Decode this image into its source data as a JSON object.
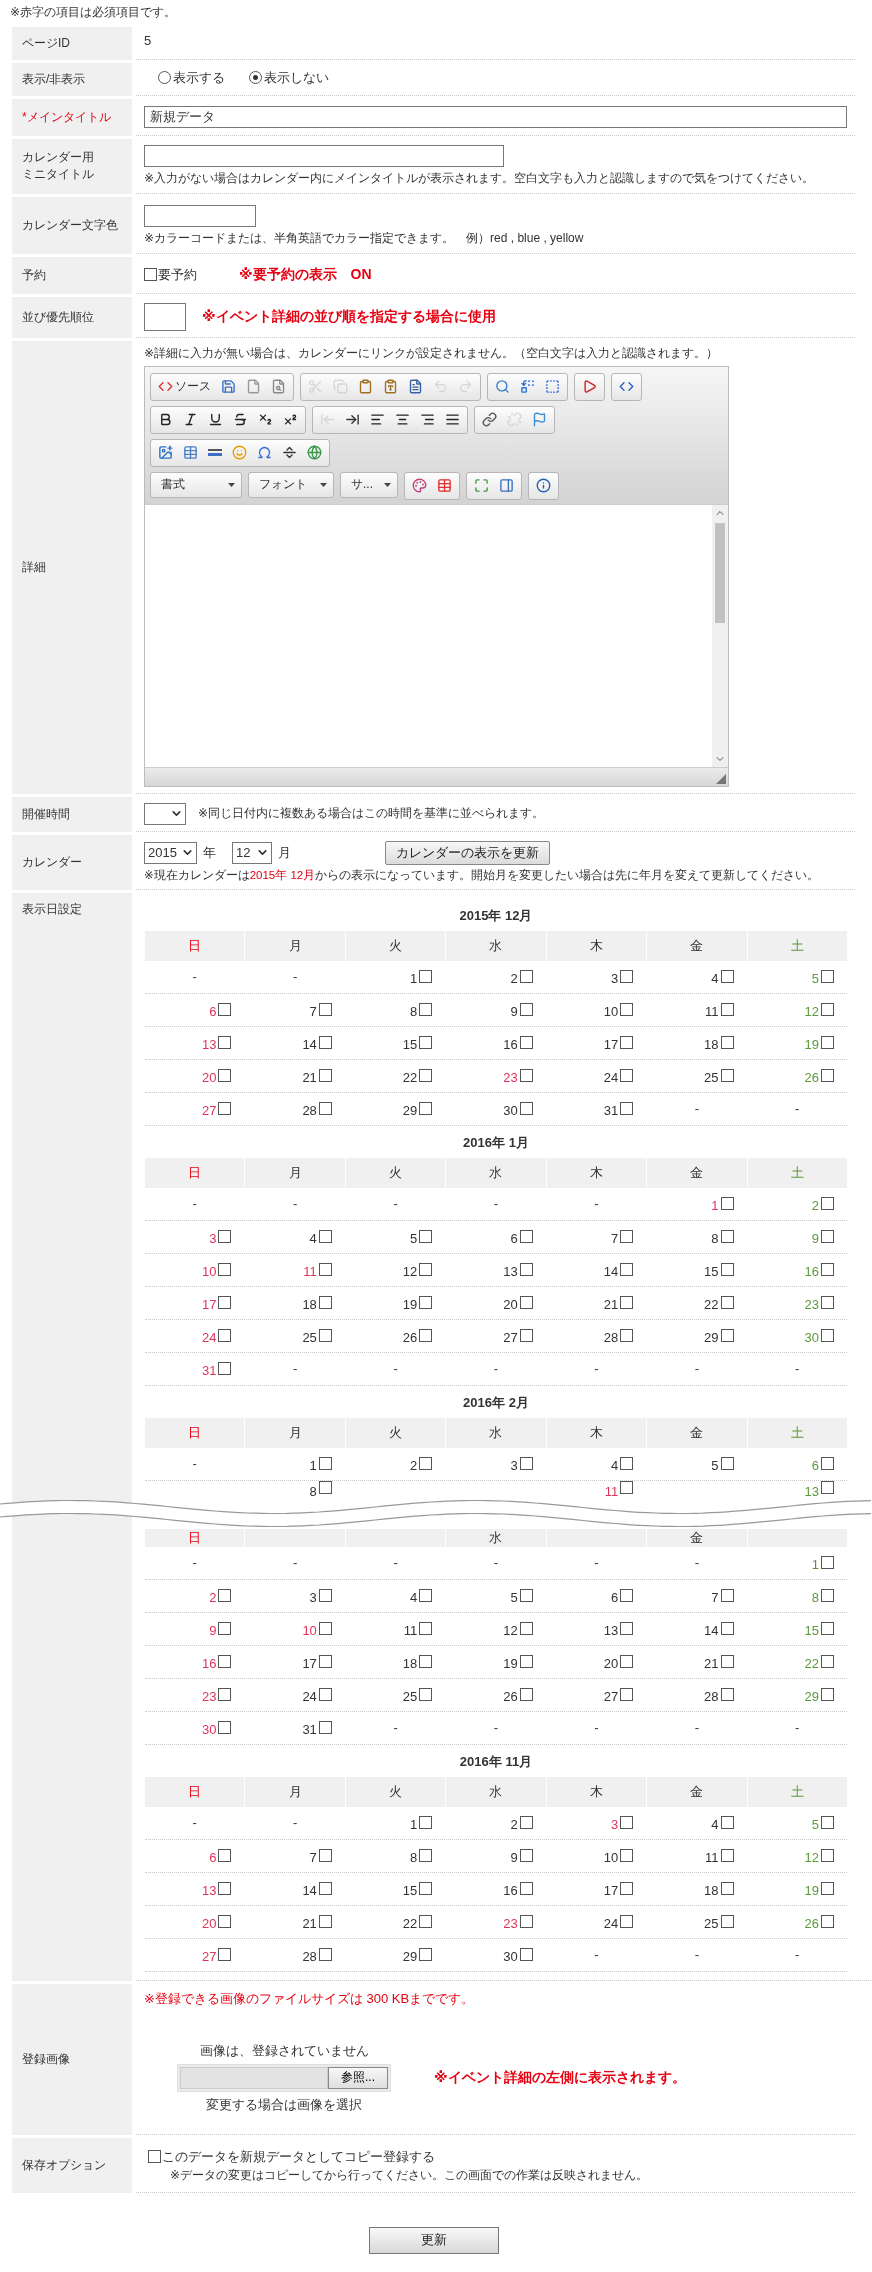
{
  "notice": "※赤字の項目は必須項目です。",
  "rows": [
    {
      "kind": "static",
      "label": "ページID",
      "required": false,
      "value": "5"
    },
    {
      "kind": "radio",
      "label": "表示/非表示",
      "required": false,
      "options": [
        {
          "label": "表示する",
          "selected": false
        },
        {
          "label": "表示しない",
          "selected": true
        }
      ]
    },
    {
      "kind": "title",
      "label": "*メインタイトル",
      "required": true,
      "value": "新規データ"
    },
    {
      "kind": "mini_title",
      "label": "カレンダー用ミニタイトル",
      "required": false,
      "note": "※入力がない場合はカレンダー内にメインタイトルが表示されます。空白文字も入力と認識しますので気をつけてください。"
    },
    {
      "kind": "color",
      "label": "カレンダー文字色",
      "required": false,
      "note": "※カラーコードまたは、半角英語でカラー指定できます。　例）red , blue , yellow"
    },
    {
      "kind": "reserve",
      "label": "予約",
      "required": false,
      "checkbox": {
        "label": "要予約",
        "checked": false
      },
      "note": "※要予約の表示　ON"
    },
    {
      "kind": "order",
      "label": "並び優先順位",
      "required": false,
      "note": "※イベント詳細の並び順を指定する場合に使用"
    },
    {
      "kind": "editor",
      "label": "詳細",
      "required": false,
      "note": "※詳細に入力が無い場合は、カレンダーにリンクが設定されません。（空白文字は入力と認識されます。）",
      "toolbar": [
        [
          {
            "kind": "buttons",
            "tools": [
              {
                "kind": "source",
                "label": "ソース",
                "disabled": false
              },
              {
                "kind": "save",
                "disabled": false
              },
              {
                "kind": "new_page",
                "disabled": false
              },
              {
                "kind": "preview",
                "disabled": false
              }
            ]
          },
          {
            "kind": "buttons",
            "tools": [
              {
                "kind": "cut",
                "disabled": true
              },
              {
                "kind": "copy",
                "disabled": true
              },
              {
                "kind": "paste",
                "disabled": false
              },
              {
                "kind": "paste_text",
                "disabled": false
              },
              {
                "kind": "paste_word",
                "disabled": false
              },
              {
                "kind": "undo",
                "disabled": true
              },
              {
                "kind": "redo",
                "disabled": true
              }
            ]
          },
          {
            "kind": "buttons",
            "tools": [
              {
                "kind": "find",
                "disabled": false
              },
              {
                "kind": "replace",
                "disabled": false
              },
              {
                "kind": "select_all",
                "disabled": false
              }
            ]
          },
          {
            "kind": "buttons",
            "tools": [
              {
                "kind": "video",
                "disabled": false
              }
            ]
          },
          {
            "kind": "buttons",
            "tools": [
              {
                "kind": "html",
                "disabled": false
              }
            ]
          }
        ],
        [
          {
            "kind": "buttons",
            "tools": [
              {
                "kind": "bold",
                "disabled": false
              },
              {
                "kind": "italic",
                "disabled": false
              },
              {
                "kind": "underline",
                "disabled": false
              },
              {
                "kind": "strike",
                "disabled": false
              },
              {
                "kind": "subscript",
                "disabled": false
              },
              {
                "kind": "superscript",
                "disabled": false
              }
            ]
          },
          {
            "kind": "buttons",
            "tools": [
              {
                "kind": "outdent",
                "disabled": true
              },
              {
                "kind": "indent",
                "disabled": false
              },
              {
                "kind": "align_left",
                "disabled": false
              },
              {
                "kind": "align_center",
                "disabled": false
              },
              {
                "kind": "align_right",
                "disabled": false
              },
              {
                "kind": "justify",
                "disabled": false
              }
            ]
          },
          {
            "kind": "buttons",
            "tools": [
              {
                "kind": "link",
                "disabled": false
              },
              {
                "kind": "unlink",
                "disabled": true
              },
              {
                "kind": "anchor",
                "disabled": false
              }
            ]
          }
        ],
        [
          {
            "kind": "buttons",
            "tools": [
              {
                "kind": "image",
                "disabled": false
              },
              {
                "kind": "table",
                "disabled": false
              },
              {
                "kind": "rule",
                "disabled": false
              },
              {
                "kind": "smiley",
                "disabled": false
              },
              {
                "kind": "special_char",
                "disabled": false
              },
              {
                "kind": "page_break",
                "disabled": false
              },
              {
                "kind": "iframe",
                "disabled": false
              }
            ]
          }
        ],
        [
          {
            "kind": "combo",
            "label": "書式"
          },
          {
            "kind": "combo",
            "label": "フォント"
          },
          {
            "kind": "combo",
            "label": "サ..."
          },
          {
            "kind": "buttons",
            "tools": [
              {
                "kind": "text_color",
                "disabled": false
              },
              {
                "kind": "bg_color",
                "disabled": false
              }
            ]
          },
          {
            "kind": "buttons",
            "tools": [
              {
                "kind": "maximize",
                "disabled": false
              },
              {
                "kind": "show_blocks",
                "disabled": false
              }
            ]
          },
          {
            "kind": "buttons",
            "tools": [
              {
                "kind": "about",
                "disabled": false
              }
            ]
          }
        ]
      ]
    },
    {
      "kind": "time",
      "label": "開催時間",
      "required": false,
      "note": "※同じ日付内に複数ある場合はこの時間を基準に並べられます。"
    },
    {
      "kind": "calendar",
      "label": "カレンダー",
      "required": false,
      "year": "2015",
      "year_unit": "年",
      "month": "12",
      "month_unit": "月",
      "button": "カレンダーの表示を更新",
      "note_before": "※現在カレンダーは",
      "note_highlight": "2015年 12月",
      "note_after": "からの表示になっています。開始月を変更したい場合は先に年月を変えて更新してください。"
    },
    {
      "kind": "days",
      "label": "表示日設定",
      "required": false,
      "months": [
        {
          "kind": "month",
          "title": "2015年 12月",
          "weekdays": [
            {
              "label": "日",
              "kind": "sunday"
            },
            {
              "label": "月",
              "kind": "weekday"
            },
            {
              "label": "火",
              "kind": "weekday"
            },
            {
              "label": "水",
              "kind": "weekday"
            },
            {
              "label": "木",
              "kind": "weekday"
            },
            {
              "label": "金",
              "kind": "weekday"
            },
            {
              "label": "土",
              "kind": "saturday"
            }
          ],
          "weeks": [
            [
              {
                "day": "-",
                "kind": "blank"
              },
              {
                "day": "-",
                "kind": "blank"
              },
              {
                "day": "1",
                "kind": "weekday",
                "checked": false
              },
              {
                "day": "2",
                "kind": "weekday",
                "checked": false
              },
              {
                "day": "3",
                "kind": "weekday",
                "checked": false
              },
              {
                "day": "4",
                "kind": "weekday",
                "checked": false
              },
              {
                "day": "5",
                "kind": "saturday",
                "checked": false
              }
            ],
            [
              {
                "day": "6",
                "kind": "sunday",
                "checked": false
              },
              {
                "day": "7",
                "kind": "weekday",
                "checked": false
              },
              {
                "day": "8",
                "kind": "weekday",
                "checked": false
              },
              {
                "day": "9",
                "kind": "weekday",
                "checked": false
              },
              {
                "day": "10",
                "kind": "weekday",
                "checked": false
              },
              {
                "day": "11",
                "kind": "weekday",
                "checked": false
              },
              {
                "day": "12",
                "kind": "saturday",
                "checked": false
              }
            ],
            [
              {
                "day": "13",
                "kind": "sunday",
                "checked": false
              },
              {
                "day": "14",
                "kind": "weekday",
                "checked": false
              },
              {
                "day": "15",
                "kind": "weekday",
                "checked": false
              },
              {
                "day": "16",
                "kind": "weekday",
                "checked": false
              },
              {
                "day": "17",
                "kind": "weekday",
                "checked": false
              },
              {
                "day": "18",
                "kind": "weekday",
                "checked": false
              },
              {
                "day": "19",
                "kind": "saturday",
                "checked": false
              }
            ],
            [
              {
                "day": "20",
                "kind": "sunday",
                "checked": false
              },
              {
                "day": "21",
                "kind": "weekday",
                "checked": false
              },
              {
                "day": "22",
                "kind": "weekday",
                "checked": false
              },
              {
                "day": "23",
                "kind": "holiday",
                "checked": false
              },
              {
                "day": "24",
                "kind": "weekday",
                "checked": false
              },
              {
                "day": "25",
                "kind": "weekday",
                "checked": false
              },
              {
                "day": "26",
                "kind": "saturday",
                "checked": false
              }
            ],
            [
              {
                "day": "27",
                "kind": "sunday",
                "checked": false
              },
              {
                "day": "28",
                "kind": "weekday",
                "checked": false
              },
              {
                "day": "29",
                "kind": "weekday",
                "checked": false
              },
              {
                "day": "30",
                "kind": "weekday",
                "checked": false
              },
              {
                "day": "31",
                "kind": "weekday",
                "checked": false
              },
              {
                "day": "-",
                "kind": "blank"
              },
              {
                "day": "-",
                "kind": "blank"
              }
            ]
          ]
        },
        {
          "kind": "month",
          "title": "2016年 1月",
          "weekdays": [
            {
              "label": "日",
              "kind": "sunday"
            },
            {
              "label": "月",
              "kind": "weekday"
            },
            {
              "label": "火",
              "kind": "weekday"
            },
            {
              "label": "水",
              "kind": "weekday"
            },
            {
              "label": "木",
              "kind": "weekday"
            },
            {
              "label": "金",
              "kind": "weekday"
            },
            {
              "label": "土",
              "kind": "saturday"
            }
          ],
          "weeks": [
            [
              {
                "day": "-",
                "kind": "blank"
              },
              {
                "day": "-",
                "kind": "blank"
              },
              {
                "day": "-",
                "kind": "blank"
              },
              {
                "day": "-",
                "kind": "blank"
              },
              {
                "day": "-",
                "kind": "blank"
              },
              {
                "day": "1",
                "kind": "holiday",
                "checked": false
              },
              {
                "day": "2",
                "kind": "saturday",
                "checked": false
              }
            ],
            [
              {
                "day": "3",
                "kind": "sunday",
                "checked": false
              },
              {
                "day": "4",
                "kind": "weekday",
                "checked": false
              },
              {
                "day": "5",
                "kind": "weekday",
                "checked": false
              },
              {
                "day": "6",
                "kind": "weekday",
                "checked": false
              },
              {
                "day": "7",
                "kind": "weekday",
                "checked": false
              },
              {
                "day": "8",
                "kind": "weekday",
                "checked": false
              },
              {
                "day": "9",
                "kind": "saturday",
                "checked": false
              }
            ],
            [
              {
                "day": "10",
                "kind": "sunday",
                "checked": false
              },
              {
                "day": "11",
                "kind": "holiday",
                "checked": false
              },
              {
                "day": "12",
                "kind": "weekday",
                "checked": false
              },
              {
                "day": "13",
                "kind": "weekday",
                "checked": false
              },
              {
                "day": "14",
                "kind": "weekday",
                "checked": false
              },
              {
                "day": "15",
                "kind": "weekday",
                "checked": false
              },
              {
                "day": "16",
                "kind": "saturday",
                "checked": false
              }
            ],
            [
              {
                "day": "17",
                "kind": "sunday",
                "checked": false
              },
              {
                "day": "18",
                "kind": "weekday",
                "checked": false
              },
              {
                "day": "19",
                "kind": "weekday",
                "checked": false
              },
              {
                "day": "20",
                "kind": "weekday",
                "checked": false
              },
              {
                "day": "21",
                "kind": "weekday",
                "checked": false
              },
              {
                "day": "22",
                "kind": "weekday",
                "checked": false
              },
              {
                "day": "23",
                "kind": "saturday",
                "checked": false
              }
            ],
            [
              {
                "day": "24",
                "kind": "sunday",
                "checked": false
              },
              {
                "day": "25",
                "kind": "weekday",
                "checked": false
              },
              {
                "day": "26",
                "kind": "weekday",
                "checked": false
              },
              {
                "day": "27",
                "kind": "weekday",
                "checked": false
              },
              {
                "day": "28",
                "kind": "weekday",
                "checked": false
              },
              {
                "day": "29",
                "kind": "weekday",
                "checked": false
              },
              {
                "day": "30",
                "kind": "saturday",
                "checked": false
              }
            ],
            [
              {
                "day": "31",
                "kind": "sunday",
                "checked": false
              },
              {
                "day": "-",
                "kind": "blank"
              },
              {
                "day": "-",
                "kind": "blank"
              },
              {
                "day": "-",
                "kind": "blank"
              },
              {
                "day": "-",
                "kind": "blank"
              },
              {
                "day": "-",
                "kind": "blank"
              },
              {
                "day": "-",
                "kind": "blank"
              }
            ]
          ]
        },
        {
          "kind": "month",
          "title": "2016年 2月",
          "weekdays": [
            {
              "label": "日",
              "kind": "sunday"
            },
            {
              "label": "月",
              "kind": "weekday"
            },
            {
              "label": "火",
              "kind": "weekday"
            },
            {
              "label": "水",
              "kind": "weekday"
            },
            {
              "label": "木",
              "kind": "weekday"
            },
            {
              "label": "金",
              "kind": "weekday"
            },
            {
              "label": "土",
              "kind": "saturday"
            }
          ],
          "weeks": [
            [
              {
                "day": "-",
                "kind": "blank"
              },
              {
                "day": "1",
                "kind": "weekday",
                "checked": false
              },
              {
                "day": "2",
                "kind": "weekday",
                "checked": false
              },
              {
                "day": "3",
                "kind": "weekday",
                "checked": false
              },
              {
                "day": "4",
                "kind": "weekday",
                "checked": false
              },
              {
                "day": "5",
                "kind": "weekday",
                "checked": false
              },
              {
                "day": "6",
                "kind": "saturday",
                "checked": false
              }
            ],
            [
              {
                "kind": "hidden"
              },
              {
                "day": "8",
                "kind": "weekday",
                "checked": false
              },
              {
                "kind": "hidden"
              },
              {
                "kind": "hidden"
              },
              {
                "day": "11",
                "kind": "holiday",
                "checked": false
              },
              {
                "kind": "hidden"
              },
              {
                "day": "13",
                "kind": "saturday",
                "checked": false
              }
            ]
          ]
        },
        {
          "kind": "break"
        },
        {
          "kind": "month",
          "weekdays": [
            {
              "label": "日",
              "kind": "sunday"
            },
            {
              "kind": "hidden"
            },
            {
              "kind": "hidden"
            },
            {
              "label": "水",
              "kind": "weekday"
            },
            {
              "kind": "hidden"
            },
            {
              "label": "金",
              "kind": "weekday"
            },
            {
              "kind": "hidden"
            }
          ],
          "weeks": [
            [
              {
                "day": "-",
                "kind": "blank"
              },
              {
                "day": "-",
                "kind": "blank"
              },
              {
                "day": "-",
                "kind": "blank"
              },
              {
                "day": "-",
                "kind": "blank"
              },
              {
                "day": "-",
                "kind": "blank"
              },
              {
                "day": "-",
                "kind": "blank"
              },
              {
                "day": "1",
                "kind": "saturday",
                "checked": false
              }
            ],
            [
              {
                "day": "2",
                "kind": "sunday",
                "checked": false
              },
              {
                "day": "3",
                "kind": "weekday",
                "checked": false
              },
              {
                "day": "4",
                "kind": "weekday",
                "checked": false
              },
              {
                "day": "5",
                "kind": "weekday",
                "checked": false
              },
              {
                "day": "6",
                "kind": "weekday",
                "checked": false
              },
              {
                "day": "7",
                "kind": "weekday",
                "checked": false
              },
              {
                "day": "8",
                "kind": "saturday",
                "checked": false
              }
            ],
            [
              {
                "day": "9",
                "kind": "sunday",
                "checked": false
              },
              {
                "day": "10",
                "kind": "holiday",
                "checked": false
              },
              {
                "day": "11",
                "kind": "weekday",
                "checked": false
              },
              {
                "day": "12",
                "kind": "weekday",
                "checked": false
              },
              {
                "day": "13",
                "kind": "weekday",
                "checked": false
              },
              {
                "day": "14",
                "kind": "weekday",
                "checked": false
              },
              {
                "day": "15",
                "kind": "saturday",
                "checked": false
              }
            ],
            [
              {
                "day": "16",
                "kind": "sunday",
                "checked": false
              },
              {
                "day": "17",
                "kind": "weekday",
                "checked": false
              },
              {
                "day": "18",
                "kind": "weekday",
                "checked": false
              },
              {
                "day": "19",
                "kind": "weekday",
                "checked": false
              },
              {
                "day": "20",
                "kind": "weekday",
                "checked": false
              },
              {
                "day": "21",
                "kind": "weekday",
                "checked": false
              },
              {
                "day": "22",
                "kind": "saturday",
                "checked": false
              }
            ],
            [
              {
                "day": "23",
                "kind": "sunday",
                "checked": false
              },
              {
                "day": "24",
                "kind": "weekday",
                "checked": false
              },
              {
                "day": "25",
                "kind": "weekday",
                "checked": false
              },
              {
                "day": "26",
                "kind": "weekday",
                "checked": false
              },
              {
                "day": "27",
                "kind": "weekday",
                "checked": false
              },
              {
                "day": "28",
                "kind": "weekday",
                "checked": false
              },
              {
                "day": "29",
                "kind": "saturday",
                "checked": false
              }
            ],
            [
              {
                "day": "30",
                "kind": "sunday",
                "checked": false
              },
              {
                "day": "31",
                "kind": "weekday",
                "checked": false
              },
              {
                "day": "-",
                "kind": "blank"
              },
              {
                "day": "-",
                "kind": "blank"
              },
              {
                "day": "-",
                "kind": "blank"
              },
              {
                "day": "-",
                "kind": "blank"
              },
              {
                "day": "-",
                "kind": "blank"
              }
            ]
          ]
        },
        {
          "kind": "month",
          "title": "2016年 11月",
          "weekdays": [
            {
              "label": "日",
              "kind": "sunday"
            },
            {
              "label": "月",
              "kind": "weekday"
            },
            {
              "label": "火",
              "kind": "weekday"
            },
            {
              "label": "水",
              "kind": "weekday"
            },
            {
              "label": "木",
              "kind": "weekday"
            },
            {
              "label": "金",
              "kind": "weekday"
            },
            {
              "label": "土",
              "kind": "saturday"
            }
          ],
          "weeks": [
            [
              {
                "day": "-",
                "kind": "blank"
              },
              {
                "day": "-",
                "kind": "blank"
              },
              {
                "day": "1",
                "kind": "weekday",
                "checked": false
              },
              {
                "day": "2",
                "kind": "weekday",
                "checked": false
              },
              {
                "day": "3",
                "kind": "holiday",
                "checked": false
              },
              {
                "day": "4",
                "kind": "weekday",
                "checked": false
              },
              {
                "day": "5",
                "kind": "saturday",
                "checked": false
              }
            ],
            [
              {
                "day": "6",
                "kind": "sunday",
                "checked": false
              },
              {
                "day": "7",
                "kind": "weekday",
                "checked": false
              },
              {
                "day": "8",
                "kind": "weekday",
                "checked": false
              },
              {
                "day": "9",
                "kind": "weekday",
                "checked": false
              },
              {
                "day": "10",
                "kind": "weekday",
                "checked": false
              },
              {
                "day": "11",
                "kind": "weekday",
                "checked": false
              },
              {
                "day": "12",
                "kind": "saturday",
                "checked": false
              }
            ],
            [
              {
                "day": "13",
                "kind": "sunday",
                "checked": false
              },
              {
                "day": "14",
                "kind": "weekday",
                "checked": false
              },
              {
                "day": "15",
                "kind": "weekday",
                "checked": false
              },
              {
                "day": "16",
                "kind": "weekday",
                "checked": false
              },
              {
                "day": "17",
                "kind": "weekday",
                "checked": false
              },
              {
                "day": "18",
                "kind": "weekday",
                "checked": false
              },
              {
                "day": "19",
                "kind": "saturday",
                "checked": false
              }
            ],
            [
              {
                "day": "20",
                "kind": "sunday",
                "checked": false
              },
              {
                "day": "21",
                "kind": "weekday",
                "checked": false
              },
              {
                "day": "22",
                "kind": "weekday",
                "checked": false
              },
              {
                "day": "23",
                "kind": "holiday",
                "checked": false
              },
              {
                "day": "24",
                "kind": "weekday",
                "checked": false
              },
              {
                "day": "25",
                "kind": "weekday",
                "checked": false
              },
              {
                "day": "26",
                "kind": "saturday",
                "checked": false
              }
            ],
            [
              {
                "day": "27",
                "kind": "sunday",
                "checked": false
              },
              {
                "day": "28",
                "kind": "weekday",
                "checked": false
              },
              {
                "day": "29",
                "kind": "weekday",
                "checked": false
              },
              {
                "day": "30",
                "kind": "weekday",
                "checked": false
              },
              {
                "day": "-",
                "kind": "blank"
              },
              {
                "day": "-",
                "kind": "blank"
              },
              {
                "day": "-",
                "kind": "blank"
              }
            ]
          ]
        }
      ]
    },
    {
      "kind": "image",
      "label": "登録画像",
      "required": false,
      "size_note": "※登録できる画像のファイルサイズは 300 KBまでです。",
      "status": "画像は、登録されていません",
      "browse_button": "参照...",
      "hint": "変更する場合は画像を選択",
      "side_note": "※イベント詳細の左側に表示されます。"
    },
    {
      "kind": "save_option",
      "label": "保存オプション",
      "required": false,
      "checkbox": {
        "label": "このデータを新規データとしてコピー登録する",
        "checked": false
      },
      "note": "※データの変更はコピーしてから行ってください。この画面での作業は反映されません。"
    }
  ],
  "submit_button": "更新"
}
